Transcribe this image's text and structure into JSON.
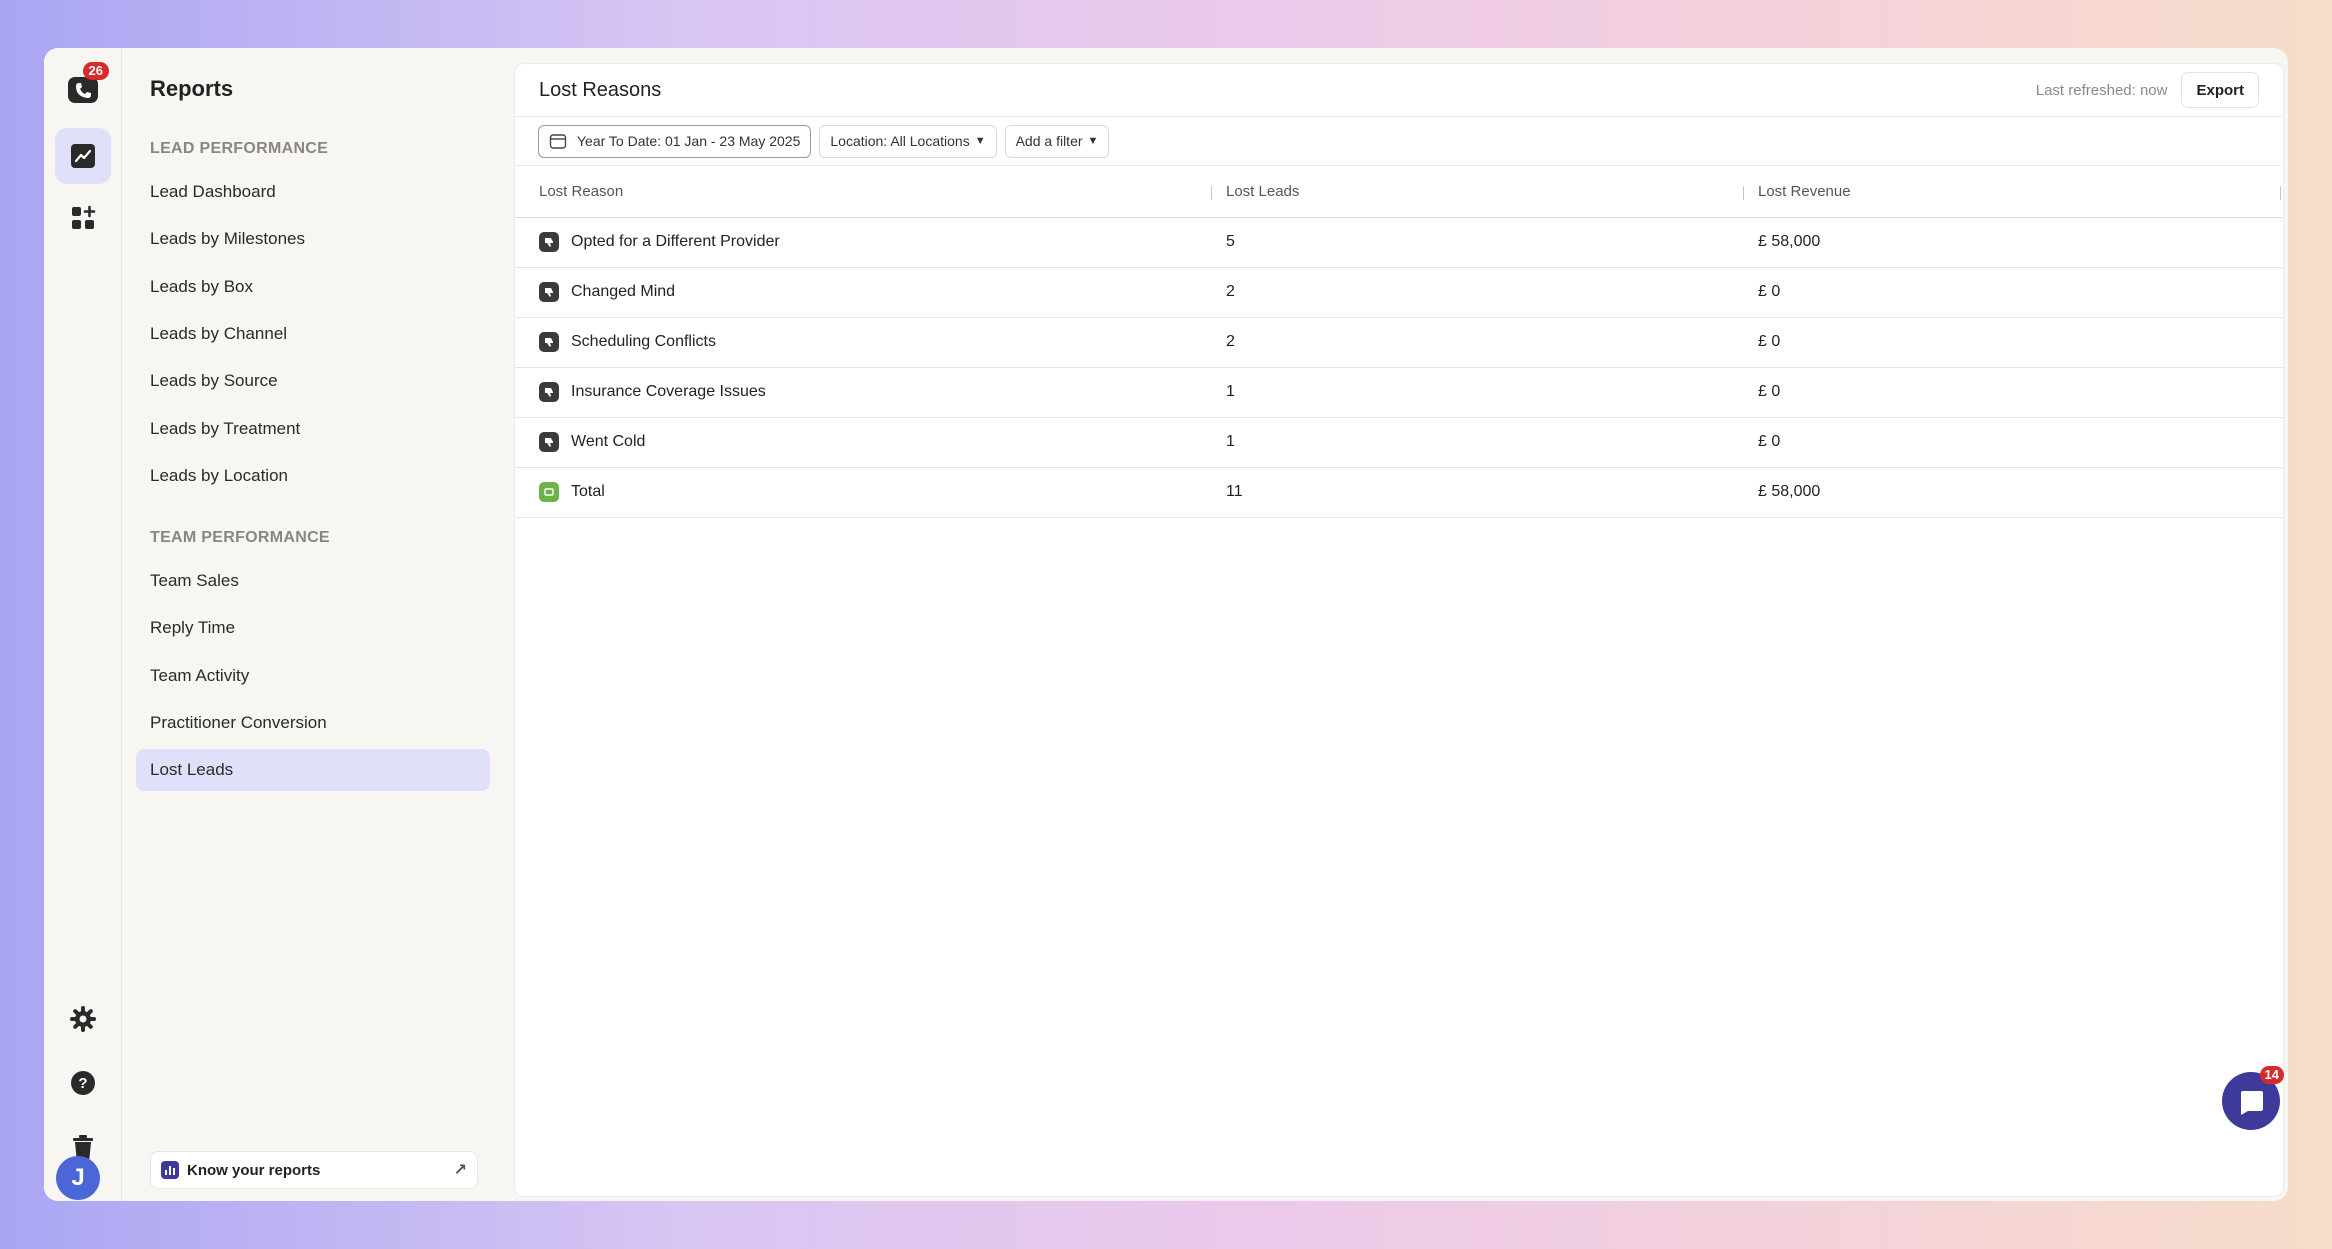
{
  "rail": {
    "logo_badge": "26",
    "avatar_initial": "J"
  },
  "sidebar": {
    "title": "Reports",
    "lead_section": "LEAD PERFORMANCE",
    "lead_items": [
      "Lead Dashboard",
      "Leads by Milestones",
      "Leads by Box",
      "Leads by Channel",
      "Leads by Source",
      "Leads by Treatment",
      "Leads by Location"
    ],
    "team_section": "TEAM PERFORMANCE",
    "team_items": [
      "Team Sales",
      "Reply Time",
      "Team Activity",
      "Practitioner Conversion",
      "Lost Leads"
    ],
    "active_item": "Lost Leads",
    "know_reports": "Know your reports"
  },
  "main": {
    "title": "Lost Reasons",
    "last_refreshed": "Last refreshed: now",
    "export_label": "Export",
    "filters": {
      "date": "Year To Date: 01 Jan - 23 May 2025",
      "location": "Location: All Locations",
      "add_filter": "Add a filter"
    },
    "columns": [
      "Lost Reason",
      "Lost Leads",
      "Lost Revenue"
    ],
    "rows": [
      {
        "reason": "Opted for a Different Provider",
        "leads": "5",
        "revenue": "£ 58,000"
      },
      {
        "reason": "Changed Mind",
        "leads": "2",
        "revenue": "£ 0"
      },
      {
        "reason": "Scheduling Conflicts",
        "leads": "2",
        "revenue": "£ 0"
      },
      {
        "reason": "Insurance Coverage Issues",
        "leads": "1",
        "revenue": "£ 0"
      },
      {
        "reason": "Went Cold",
        "leads": "1",
        "revenue": "£ 0"
      },
      {
        "reason": "Total",
        "leads": "11",
        "revenue": "£ 58,000"
      }
    ]
  },
  "chat": {
    "badge": "14"
  },
  "colors": {
    "accent": "#3d3a9a",
    "active_bg": "#e1e0fb",
    "badge_red": "#d62b2b",
    "total_green": "#6db24a"
  }
}
